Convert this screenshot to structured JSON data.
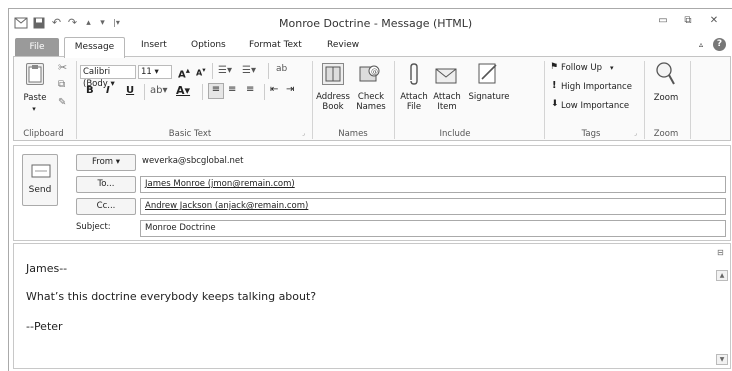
{
  "window": {
    "title": "Monroe Doctrine  -  Message (HTML)",
    "controls": {
      "minimize": "▭",
      "restore": "⧉",
      "close": "✕"
    }
  },
  "tabs": {
    "file": "File",
    "items": [
      "Message",
      "Insert",
      "Options",
      "Format Text",
      "Review"
    ]
  },
  "ribbon": {
    "clipboard": {
      "paste": "Paste",
      "label": "Clipboard"
    },
    "basic_text": {
      "font": "Calibri (Body",
      "size": "11",
      "label": "Basic Text",
      "bold": "B",
      "italic": "I",
      "underline": "U"
    },
    "names": {
      "address_book": "Address Book",
      "check_names": "Check Names",
      "label": "Names"
    },
    "include": {
      "attach_file": "Attach File",
      "attach_item": "Attach Item",
      "signature": "Signature",
      "label": "Include"
    },
    "tags": {
      "follow_up": "Follow Up",
      "high_importance": "High Importance",
      "low_importance": "Low Importance",
      "label": "Tags"
    },
    "zoom": {
      "zoom": "Zoom",
      "label": "Zoom"
    }
  },
  "header": {
    "send": "Send",
    "from_button": "From",
    "from_value": "weverka@sbcglobal.net",
    "to_button": "To...",
    "to_value": "James Monroe (jmon@remain.com)",
    "cc_button": "Cc...",
    "cc_value": "Andrew Jackson (anjack@remain.com)",
    "subject_label": "Subject:",
    "subject_value": "Monroe Doctrine"
  },
  "body": {
    "lines": [
      "James--",
      "What’s this doctrine everybody keeps talking about?",
      "--Peter"
    ]
  },
  "colors": {
    "file_tab": "#9a9a9a",
    "border": "#c4c4c4"
  }
}
